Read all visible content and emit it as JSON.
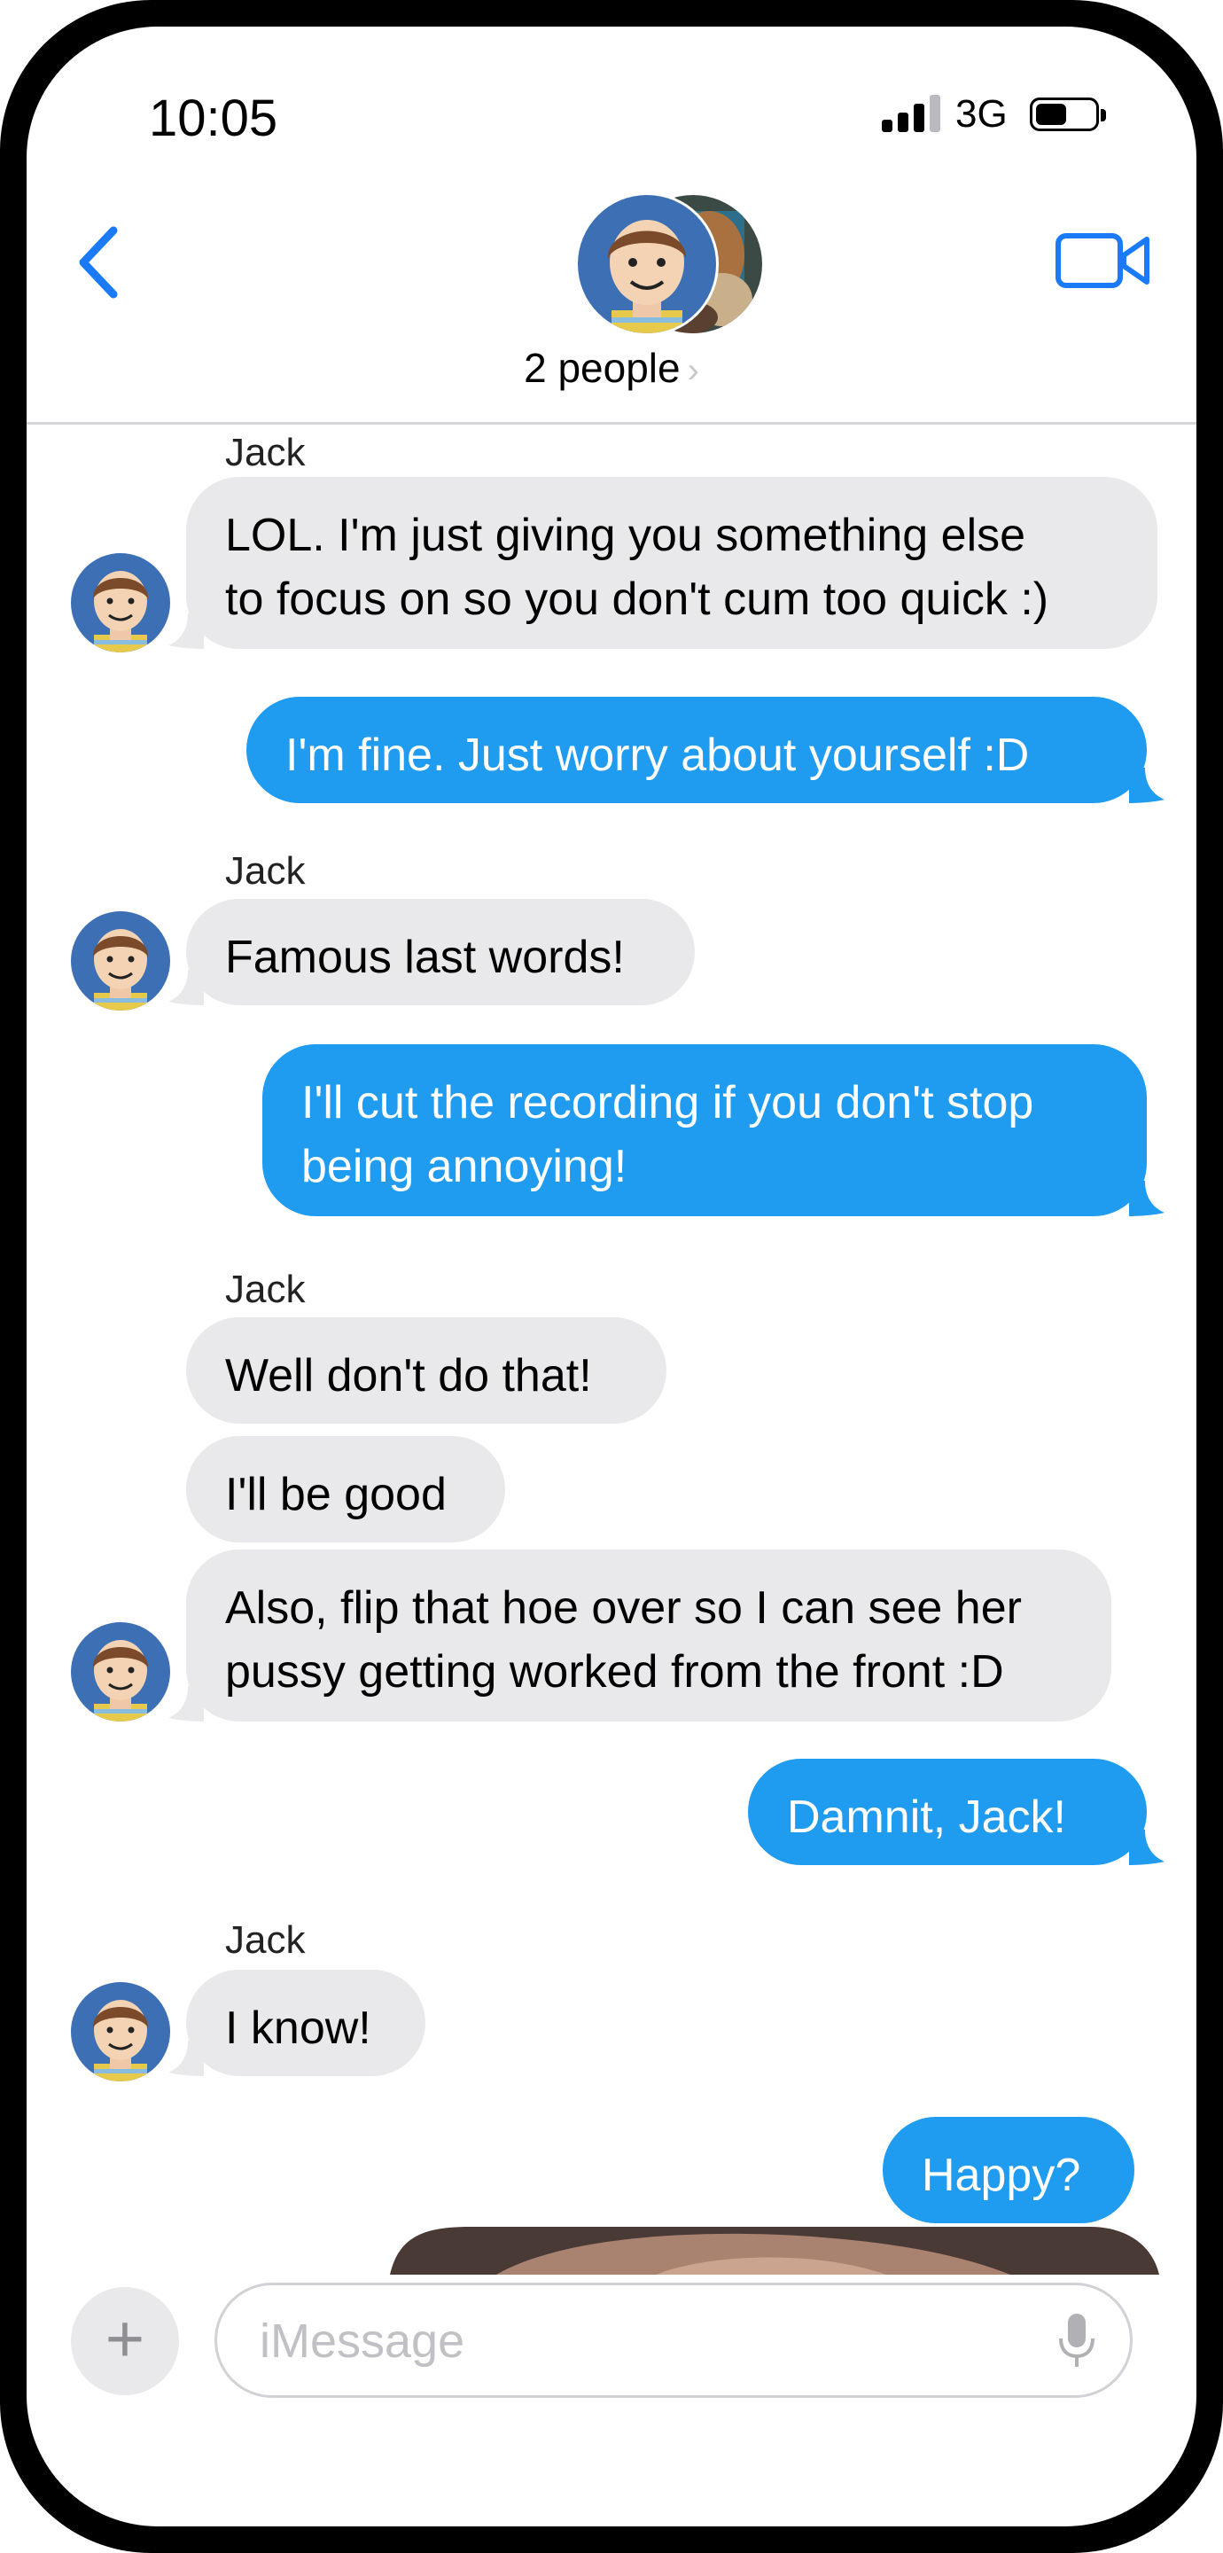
{
  "status": {
    "time": "10:05",
    "network": "3G"
  },
  "header": {
    "people_label": "2 people",
    "chevron": "›"
  },
  "messages": [
    {
      "sender": "Jack",
      "side": "received",
      "text": [
        "LOL.  I'm just giving you something else",
        "to focus on so you don't cum too quick :)"
      ]
    },
    {
      "side": "sent",
      "text": [
        "I'm fine.  Just worry about yourself :D"
      ]
    },
    {
      "sender": "Jack",
      "side": "received",
      "text": [
        "Famous last words!"
      ]
    },
    {
      "side": "sent",
      "text": [
        "I'll cut the recording if you don't stop",
        "being annoying!"
      ]
    },
    {
      "sender": "Jack",
      "side": "received",
      "text": [
        "Well don't do that!"
      ]
    },
    {
      "side": "received",
      "text": [
        "I'll be good"
      ]
    },
    {
      "side": "received",
      "text": [
        "Also, flip that hoe over so I can see her",
        "pussy getting worked from the front :D"
      ]
    },
    {
      "side": "sent",
      "text": [
        "Damnit, Jack!"
      ]
    },
    {
      "sender": "Jack",
      "side": "received",
      "text": [
        "I know!"
      ]
    },
    {
      "side": "sent",
      "text": [
        "Happy?"
      ]
    }
  ],
  "input": {
    "placeholder": "iMessage",
    "plus": "+"
  },
  "colors": {
    "sent_bubble": "#1f9bf0",
    "received_bubble": "#e9e9eb",
    "accent": "#1a7af8"
  }
}
